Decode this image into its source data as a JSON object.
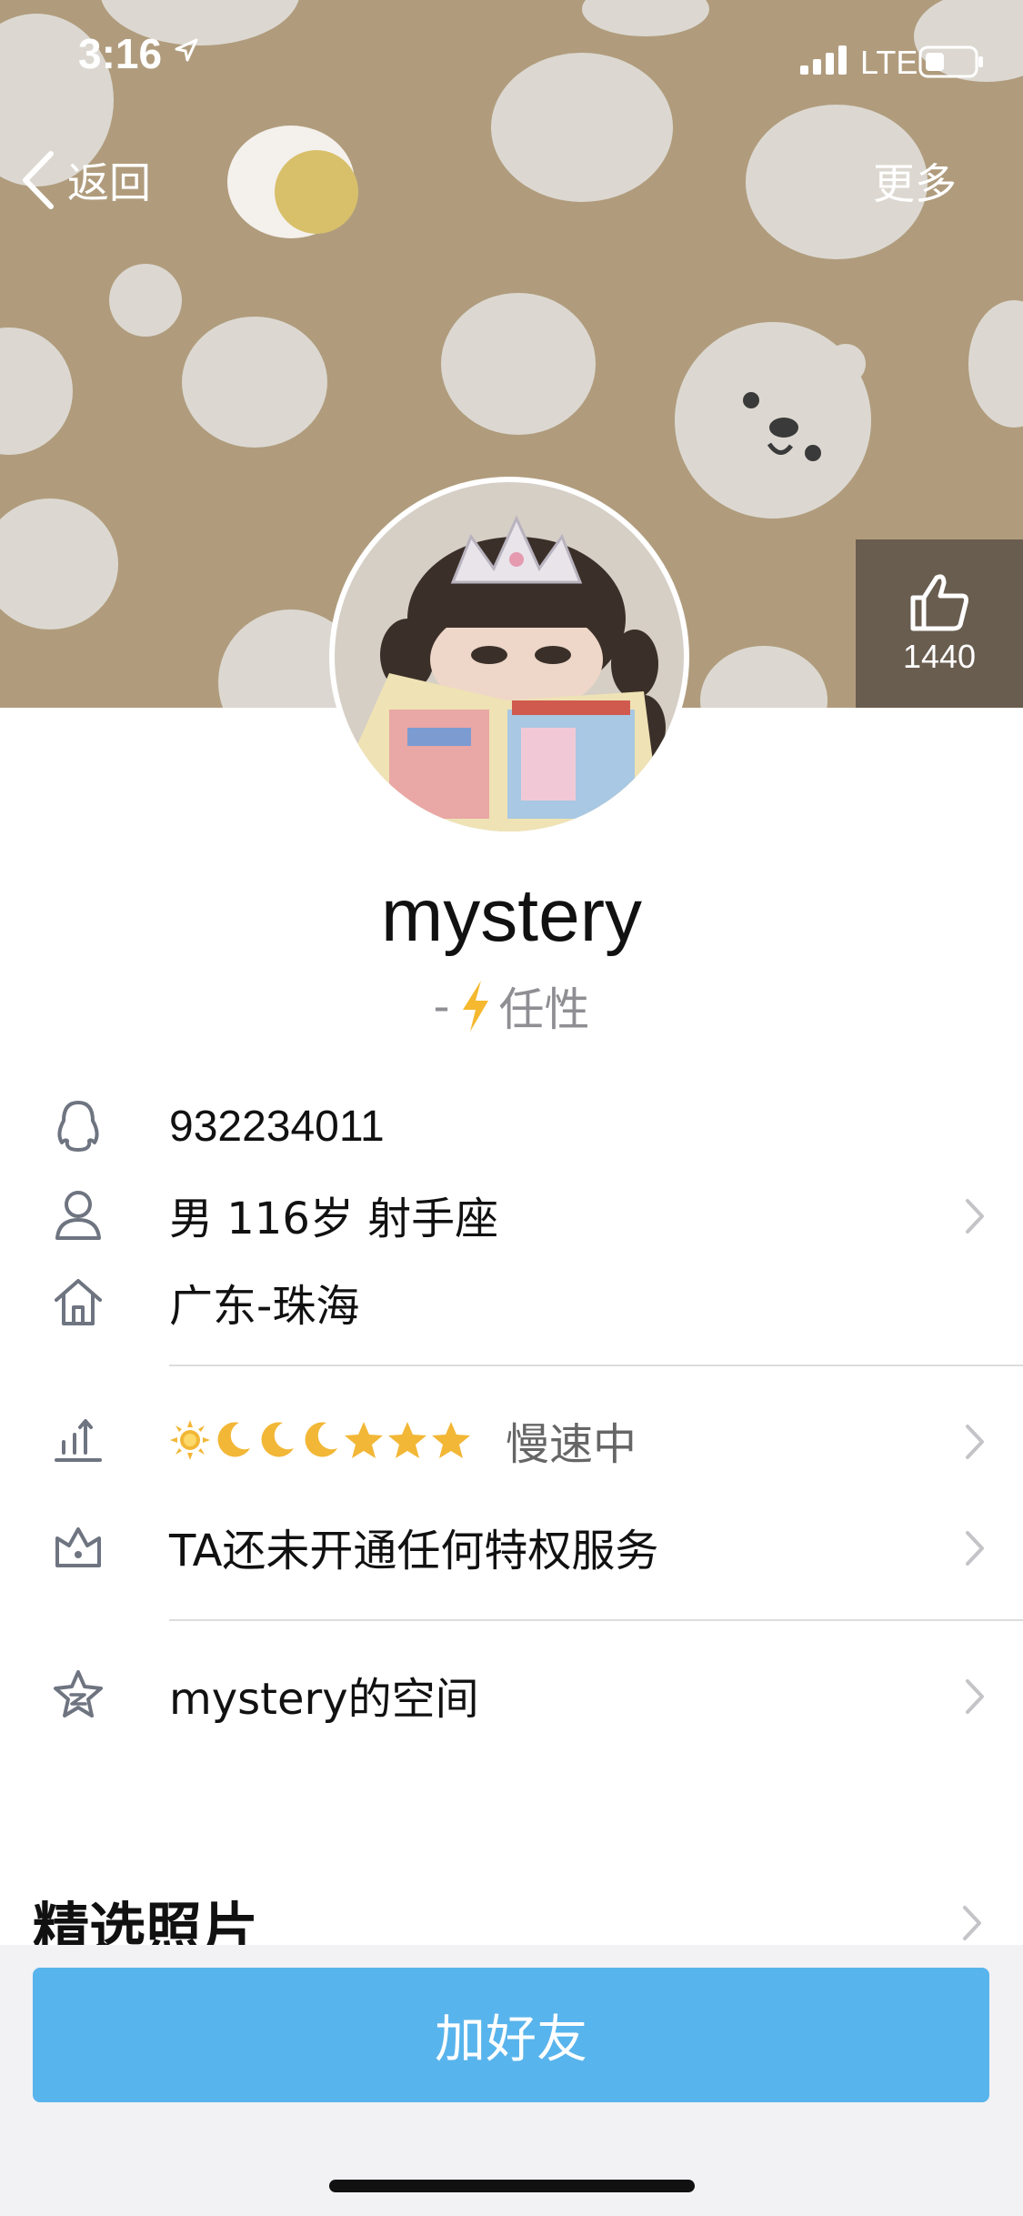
{
  "status_bar": {
    "time": "3:16",
    "network": "LTE"
  },
  "nav": {
    "back_label": "返回",
    "more_label": "更多"
  },
  "like": {
    "count": "1440"
  },
  "profile": {
    "name": "mystery",
    "signature_dash": "-",
    "signature_text": "任性"
  },
  "info": {
    "qq_number": "932234011",
    "basic_info": "男 116岁 射手座",
    "location": "广东-珠海",
    "level_status": "慢速中",
    "privilege": "TA还未开通任何特权服务",
    "space": "mystery的空间"
  },
  "photos": {
    "title": "精选照片"
  },
  "actions": {
    "add_friend": "加好友"
  },
  "colors": {
    "header_bg": "#b09c7d",
    "button_bg": "#58b4ec",
    "bolt": "#f5b82e"
  },
  "icons": {
    "level_icons": [
      "sun-icon",
      "moon-icon",
      "moon-icon",
      "moon-icon",
      "star-icon",
      "star-icon",
      "star-icon"
    ]
  }
}
